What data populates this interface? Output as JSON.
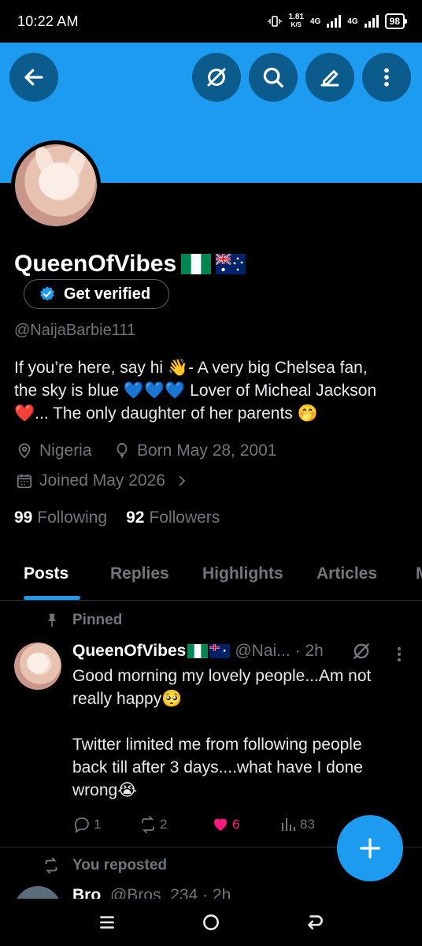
{
  "status_bar": {
    "time": "10:22 AM",
    "speed_value": "1.81",
    "speed_unit": "K/S",
    "network_1": "4G",
    "network_2": "4G",
    "battery": "98"
  },
  "header": {
    "back_icon": "arrow-left-icon",
    "grok_icon": "grok-icon",
    "search_icon": "search-icon",
    "edit_icon": "pencil-icon",
    "more_icon": "more-vertical-icon"
  },
  "profile": {
    "display_name": "QueenOfVibes",
    "flags": [
      "nigeria-flag",
      "australia-flag"
    ],
    "get_verified_label": "Get verified",
    "handle": "@NaijaBarbie111",
    "bio_line1": "If you’re here, say hi 👋- A very big Chelsea fan,",
    "bio_line2": "the sky is blue 💙💙💙 Lover of Micheal Jackson",
    "bio_line3": "❤️...  The only daughter of her parents 🤭",
    "location": "Nigeria",
    "birthday": "Born May 28, 2001",
    "joined": "Joined May 2026",
    "following_count": "99",
    "following_label": "Following",
    "followers_count": "92",
    "followers_label": "Followers"
  },
  "tabs": [
    {
      "label": "Posts",
      "active": true
    },
    {
      "label": "Replies",
      "active": false
    },
    {
      "label": "Highlights",
      "active": false
    },
    {
      "label": "Articles",
      "active": false
    }
  ],
  "pinned_tweet": {
    "pinned_label": "Pinned",
    "author_name": "QueenOfVibes",
    "author_handle": "@Nai...",
    "time": "· 2h",
    "text_line1": "Good morning my lovely people...Am not",
    "text_line2": "really happy🥺",
    "text_line3": "Twitter limited me from following people",
    "text_line4": "back till after 3 days....what have I done",
    "text_line5": "wrong😭",
    "replies": "1",
    "reposts": "2",
    "likes": "6",
    "views": "83"
  },
  "reposted_tweet": {
    "reposted_label": "You reposted",
    "author_name": "Bro",
    "author_handle": "@Bros_234",
    "time": "· 2h"
  },
  "colors": {
    "accent": "#1d9bf0",
    "banner": "#1d9bf0",
    "like": "#f91880",
    "muted": "#71767b"
  }
}
